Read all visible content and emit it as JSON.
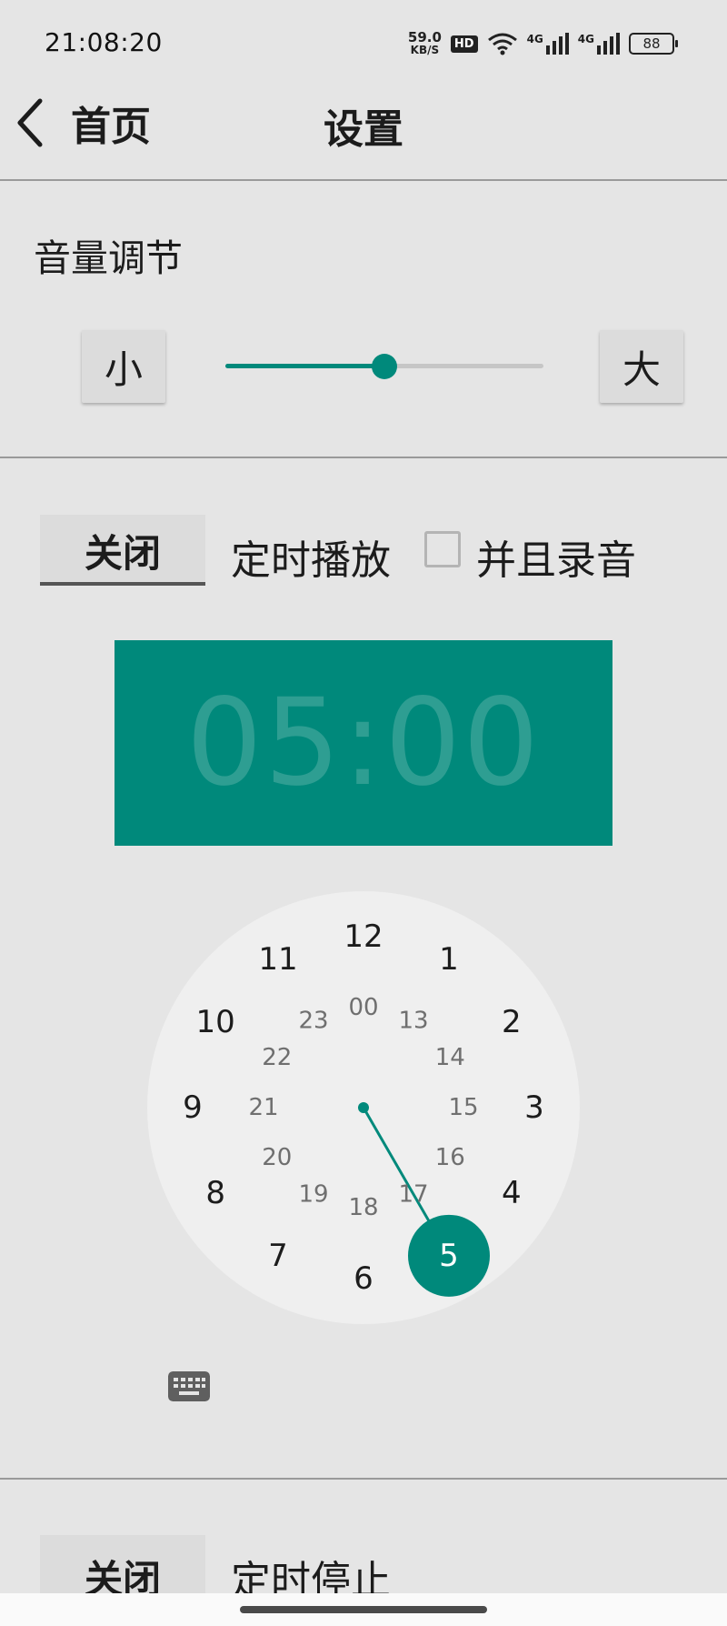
{
  "status_bar": {
    "time": "21:08:20",
    "net_speed": "59.0",
    "net_unit": "KB/S",
    "hd": "HD",
    "sim1": "4G",
    "sim2": "4G",
    "battery": "88"
  },
  "header": {
    "back_label": "首页",
    "title": "设置"
  },
  "volume": {
    "title": "音量调节",
    "low_label": "小",
    "high_label": "大",
    "level": 0.5
  },
  "timer_play": {
    "toggle_label": "关闭",
    "label": "定时播放",
    "record_label": "并且录音",
    "record_checked": false
  },
  "time_picker": {
    "display": "05:00",
    "selected_hour": "5",
    "outer_hours": [
      "12",
      "1",
      "2",
      "3",
      "4",
      "5",
      "6",
      "7",
      "8",
      "9",
      "10",
      "11"
    ],
    "inner_hours": [
      "00",
      "13",
      "14",
      "15",
      "16",
      "17",
      "18",
      "19",
      "20",
      "21",
      "22",
      "23"
    ]
  },
  "timer_stop": {
    "toggle_label": "关闭",
    "label": "定时停止"
  },
  "colors": {
    "accent": "#00897b",
    "background": "#e5e5e5",
    "clock_face": "#efefef"
  },
  "icons": {
    "back": "chevron-left-icon",
    "keyboard": "keyboard-icon",
    "wifi": "wifi-icon",
    "signal": "signal-icon",
    "battery": "battery-icon"
  }
}
